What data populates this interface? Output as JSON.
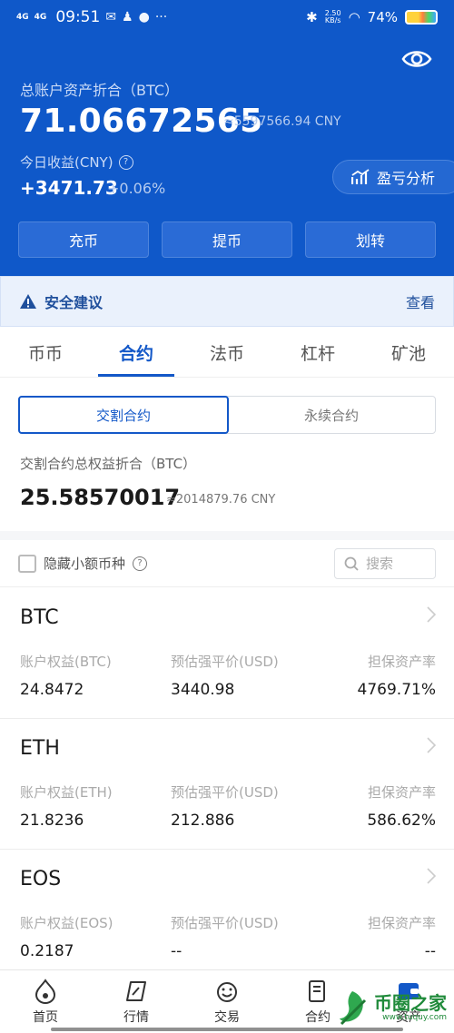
{
  "status_bar": {
    "signal_1": "4G",
    "signal_2": "4G",
    "time": "09:51",
    "speed_value": "2.50",
    "speed_unit": "KB/s",
    "battery": "74%"
  },
  "header": {
    "total_label": "总账户资产折合（BTC）",
    "total_value": "71.06672565",
    "total_cny": "≈5597566.94 CNY",
    "today_label": "今日收益(CNY)",
    "today_value": "+3471.73",
    "today_pct": "+0.06%",
    "pnl_button": "盈亏分析",
    "actions": [
      "充币",
      "提币",
      "划转"
    ]
  },
  "safety": {
    "text": "安全建议",
    "link": "查看"
  },
  "tabs": [
    "币币",
    "合约",
    "法币",
    "杠杆",
    "矿池"
  ],
  "active_tab": "合约",
  "subtabs": [
    "交割合约",
    "永续合约"
  ],
  "contract": {
    "label": "交割合约总权益折合（BTC）",
    "value": "25.58570017",
    "cny": "≈2014879.76 CNY"
  },
  "filter": {
    "hide_label": "隐藏小额币种",
    "search_placeholder": "搜索"
  },
  "coins": [
    {
      "name": "BTC",
      "equity_label": "账户权益(BTC)",
      "equity": "24.8472",
      "liq_label": "预估强平价(USD)",
      "liq": "3440.98",
      "margin_label": "担保资产率",
      "margin": "4769.71%"
    },
    {
      "name": "ETH",
      "equity_label": "账户权益(ETH)",
      "equity": "21.8236",
      "liq_label": "预估强平价(USD)",
      "liq": "212.886",
      "margin_label": "担保资产率",
      "margin": "586.62%"
    },
    {
      "name": "EOS",
      "equity_label": "账户权益(EOS)",
      "equity": "0.2187",
      "liq_label": "预估强平价(USD)",
      "liq": "--",
      "margin_label": "担保资产率",
      "margin": "--"
    }
  ],
  "bottom_nav": [
    "首页",
    "行情",
    "交易",
    "合约",
    "资产"
  ],
  "watermark": {
    "text": "币圈之家",
    "url": "www.tuquy.com"
  },
  "colors": {
    "brand_blue": "#0f58c9",
    "active_blue": "#1358c8"
  }
}
